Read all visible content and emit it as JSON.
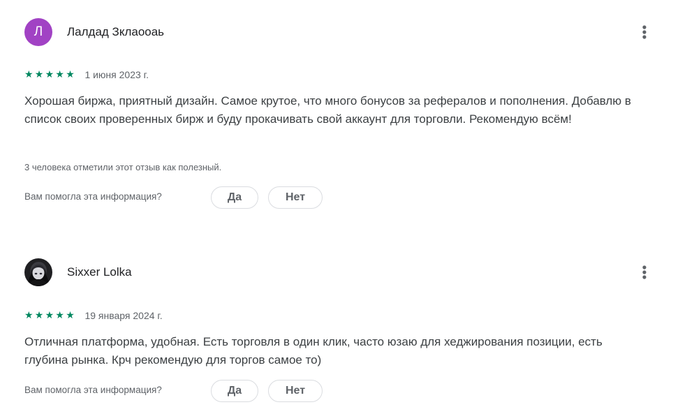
{
  "reviews": [
    {
      "author": "Лалдад Зклаооаь",
      "avatar_letter": "Л",
      "avatar_color": "#a142c4",
      "rating": 5,
      "date": "1 июня 2023 г.",
      "text": "Хорошая биржа, приятный дизайн. Самое крутое, что много бонусов за рефералов и пополнения. Добавлю в список своих проверенных бирж и буду прокачивать свой аккаунт для торговли. Рекомендую всём!",
      "helpful_count_text": "3 человека отметили этот отзыв как полезный.",
      "feedback_question": "Вам помогла эта информация?",
      "yes_label": "Да",
      "no_label": "Нет"
    },
    {
      "author": "Sixxer Lolka",
      "avatar_icon": "dark-anime-portrait",
      "rating": 5,
      "date": "19 января 2024 г.",
      "text": "Отличная платформа, удобная. Есть торговля в один клик, часто юзаю для хеджирования позиции, есть глубина рынка. Крч рекомендую для торгов самое то)",
      "feedback_question": "Вам помогла эта информация?",
      "yes_label": "Да",
      "no_label": "Нет"
    }
  ],
  "colors": {
    "star": "#01875f",
    "pill_border": "#dadce0",
    "secondary_text": "#5f6368"
  },
  "icons": {
    "more": "more-vert-icon",
    "star": "star-icon"
  }
}
